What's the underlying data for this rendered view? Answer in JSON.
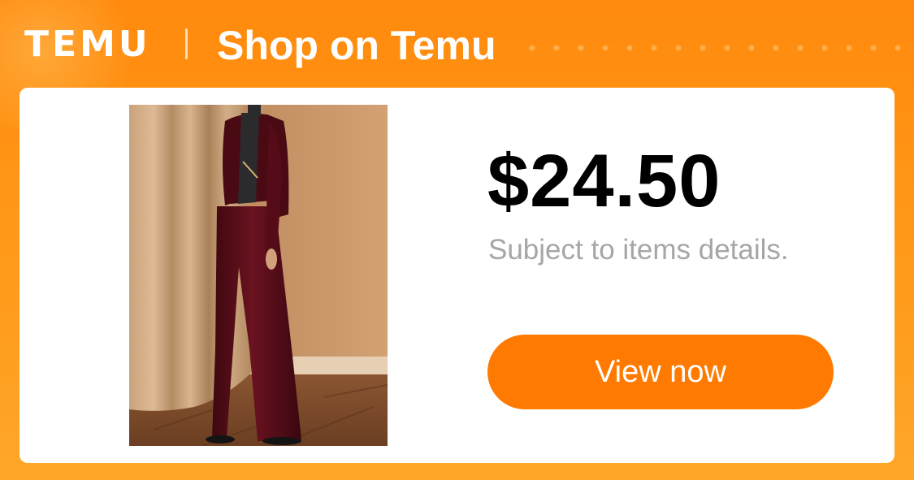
{
  "header": {
    "logo_text": "TEMU",
    "title": "Shop on Temu"
  },
  "product": {
    "image_alt": "Woman wearing burgundy velvet jacket and wide-leg trousers",
    "price": "$24.50",
    "subtext": "Subject to items details.",
    "cta_label": "View now"
  },
  "colors": {
    "brand_orange": "#FF8A0D",
    "button_orange": "#FF7A00",
    "price_text": "#000000",
    "subtext_gray": "#A6A6A6"
  }
}
